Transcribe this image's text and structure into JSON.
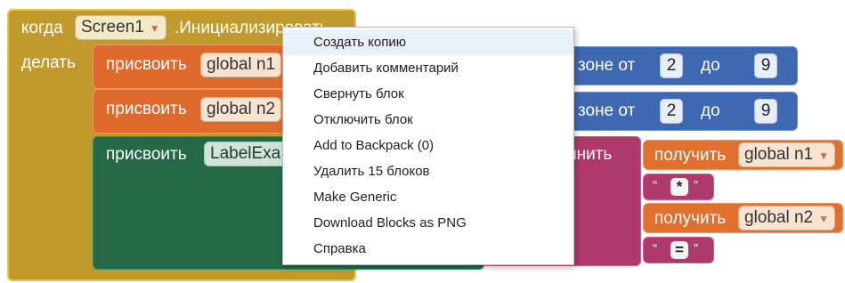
{
  "event": {
    "when_label": "когда",
    "component": "Screen1",
    "event_name": ".Инициализировать",
    "do_label": "делать"
  },
  "set1": {
    "set_label": "присвоить",
    "var": "global n1",
    "random_text": "зоне от",
    "from": "2",
    "to_label": "до",
    "to": "9"
  },
  "set2": {
    "set_label": "присвоить",
    "var": "global n2",
    "random_text": "зоне от",
    "from": "2",
    "to_label": "до",
    "to": "9"
  },
  "set3": {
    "set_label": "присвоить",
    "target": "LabelExa",
    "join_label": "инить"
  },
  "join_items": {
    "get_label": "получить",
    "var1": "global n1",
    "str1": "*",
    "var2": "global n2",
    "str2": "="
  },
  "context_menu": {
    "items": [
      "Создать копию",
      "Добавить комментарий",
      "Свернуть блок",
      "Отключить блок",
      "Add to Backpack (0)",
      "Удалить 15 блоков",
      "Make Generic",
      "Download Blocks as PNG",
      "Справка"
    ]
  },
  "colors": {
    "event": "#c19a2d",
    "set": "#df6a2d",
    "math": "#3f68b2",
    "text": "#b0396b",
    "component_set": "#246847"
  }
}
